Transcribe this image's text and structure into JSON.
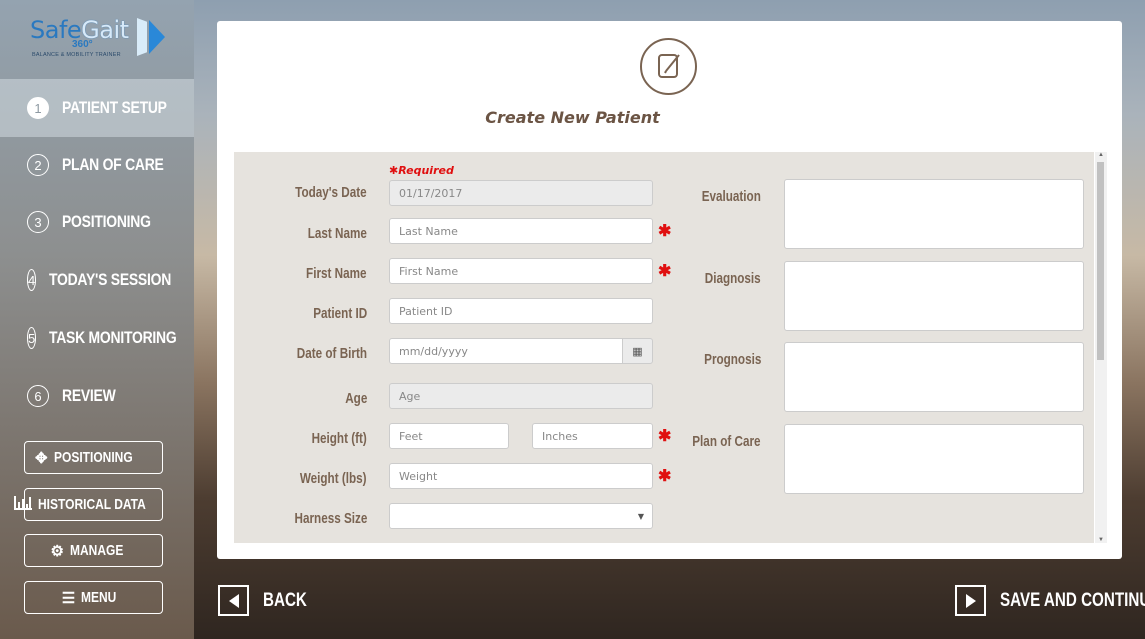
{
  "app": {
    "logo_word_a": "Safe",
    "logo_word_b": "Gait",
    "logo_badge": "360°",
    "logo_tagline": "BALANCE & MOBILITY TRAINER"
  },
  "steps": [
    {
      "num": "1",
      "label": "PATIENT SETUP"
    },
    {
      "num": "2",
      "label": "PLAN OF CARE"
    },
    {
      "num": "3",
      "label": "POSITIONING"
    },
    {
      "num": "4",
      "label": "TODAY'S SESSION"
    },
    {
      "num": "5",
      "label": "TASK MONITORING"
    },
    {
      "num": "6",
      "label": "REVIEW"
    }
  ],
  "side_buttons": {
    "positioning": "POSITIONING",
    "historical": "HISTORICAL DATA",
    "manage": "MANAGE",
    "menu": "MENU"
  },
  "page": {
    "title": "Create New Patient",
    "required_note": "✱Required"
  },
  "form": {
    "todays_date_label": "Today's Date",
    "todays_date_value": "01/17/2017",
    "last_name_label": "Last Name",
    "last_name_placeholder": "Last Name",
    "first_name_label": "First Name",
    "first_name_placeholder": "First Name",
    "patient_id_label": "Patient ID",
    "patient_id_placeholder": "Patient ID",
    "dob_label": "Date of Birth",
    "dob_placeholder": "mm/dd/yyyy",
    "age_label": "Age",
    "age_placeholder": "Age",
    "height_label": "Height  (ft)",
    "height_feet_placeholder": "Feet",
    "height_inches_placeholder": "Inches",
    "weight_label": "Weight  (lbs)",
    "weight_placeholder": "Weight",
    "harness_label": "Harness Size",
    "evaluation_label": "Evaluation",
    "diagnosis_label": "Diagnosis",
    "prognosis_label": "Prognosis",
    "plan_of_care_label": "Plan of Care",
    "required_mark": "✱"
  },
  "nav": {
    "back": "BACK",
    "save": "SAVE AND CONTINUE"
  },
  "colors": {
    "accent_brown": "#7a6452",
    "required_red": "#e01010",
    "logo_blue": "#2a79c0"
  }
}
